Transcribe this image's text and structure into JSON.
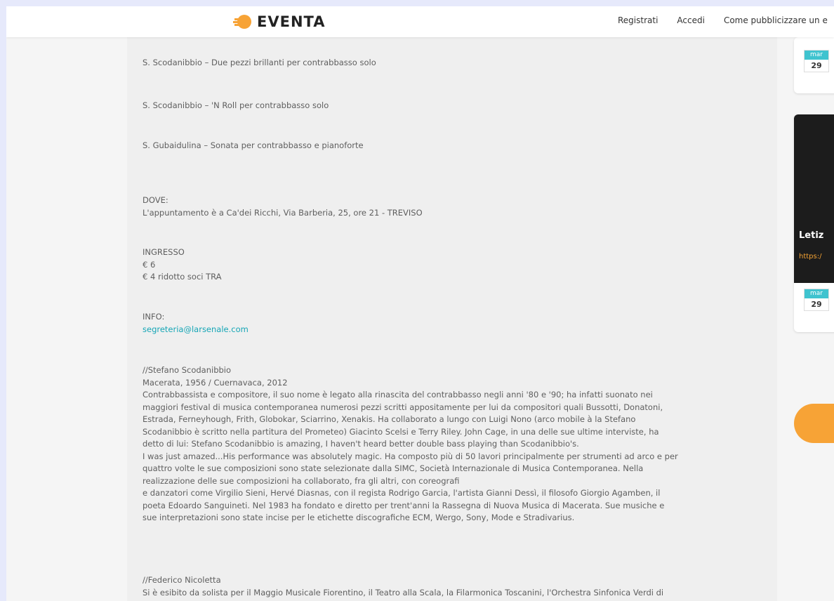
{
  "header": {
    "logo": "EVENTA",
    "nav": [
      "Registrati",
      "Accedi",
      "Come pubblicizzare un e"
    ]
  },
  "body": {
    "works": [
      "S. Scodanibbio – Due pezzi brillanti per contrabbasso solo",
      "S. Scodanibbio – 'N Roll per contrabbasso solo",
      "S. Gubaidulina – Sonata per contrabbasso e pianoforte"
    ],
    "dove_label": "DOVE:",
    "dove_text": "L'appuntamento è a Ca'dei Ricchi, Via Barberia, 25, ore 21 - TREVISO",
    "ingresso_label": "INGRESSO",
    "price_full": "€ 6",
    "price_reduced": "€ 4 ridotto soci TRA",
    "info_label": "INFO:",
    "info_email": "segreteria@larsenale.com",
    "bio1_name": "//Stefano Scodanibbio",
    "bio1_dates": "Macerata, 1956 / Cuernavaca, 2012",
    "bio1_lines": [
      "Contrabbassista e compositore, il suo nome è legato alla rinascita del contrabbasso negli anni '80 e '90; ha infatti suonato nei",
      "maggiori festival di musica contemporanea numerosi pezzi scritti appositamente per lui da compositori quali Bussotti, Donatoni,",
      "Estrada, Ferneyhough, Frith, Globokar, Sciarrino, Xenakis. Ha collaborato a lungo con Luigi Nono (arco mobile à la Stefano",
      "Scodanibbio è scritto nella partitura del Prometeo) Giacinto Scelsi e Terry Riley. John Cage, in una delle sue ultime interviste, ha",
      "detto di lui: Stefano Scodanibbio is amazing, I haven't heard better double bass playing than Scodanibbio's.",
      "I was just amazed...His performance was absolutely magic. Ha composto più di 50 lavori principalmente per strumenti ad arco e per",
      "quattro volte le sue composizioni sono state selezionate dalla SIMC, Società Internazionale di Musica Contemporanea. Nella",
      "realizzazione delle sue composizioni ha collaborato, fra gli altri, con coreografi",
      "e danzatori come Virgilio Sieni, Hervé Diasnas, con il regista Rodrigo Garcia, l'artista Gianni Dessì, il filosofo Giorgio Agamben, il",
      "poeta Edoardo Sanguineti. Nel 1983 ha fondato e diretto per trent'anni la Rassegna di Nuova Musica di Macerata. Sue musiche e",
      "sue interpretazioni sono state incise per le etichette discografiche ECM, Wergo, Sony, Mode e Stradivarius."
    ],
    "bio2_name": "//Federico Nicoletta",
    "bio2_line": "Si è esibito da solista per il Maggio Musicale Fiorentino, il Teatro alla Scala, la Filarmonica Toscanini, l'Orchestra Sinfonica Verdi di"
  },
  "sidebar": {
    "date1": {
      "month": "mar",
      "day": "29"
    },
    "card_title": "Letiz",
    "card_url": "https:/",
    "date2": {
      "month": "mar",
      "day": "29"
    }
  },
  "colors": {
    "accent": "#3fc3cf",
    "link": "#16a6b6",
    "orange": "#f7a336"
  }
}
